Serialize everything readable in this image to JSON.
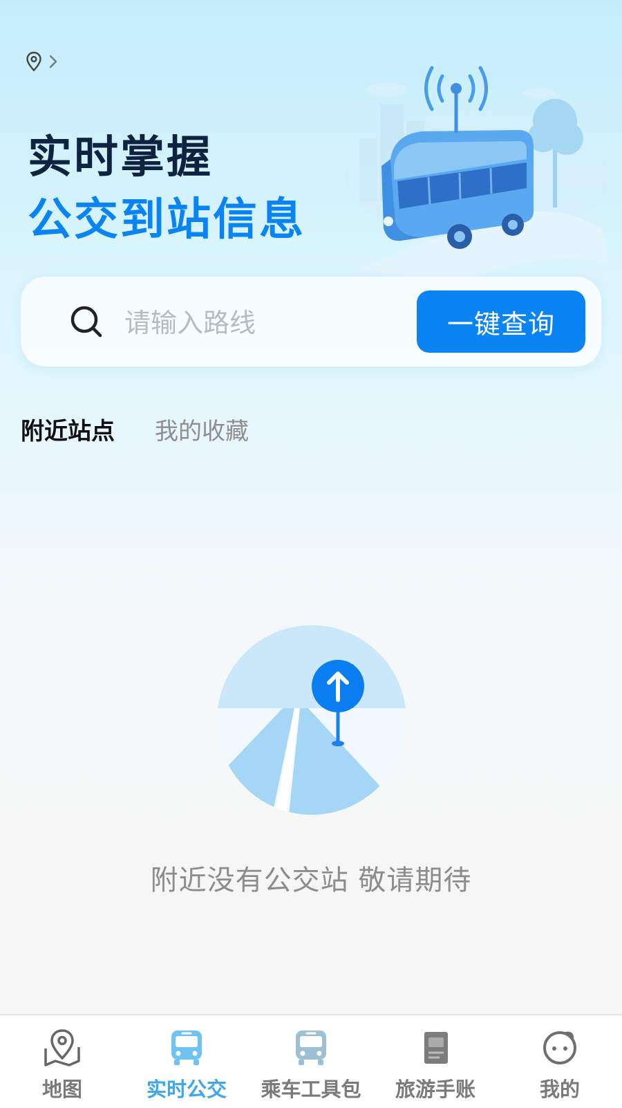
{
  "header": {
    "location_icon": "location-pin-icon",
    "chevron_icon": "chevron-right-icon",
    "headline_line1": "实时掌握",
    "headline_line2": "公交到站信息",
    "hero_image": "bus-with-signal-illustration"
  },
  "search": {
    "icon": "search-icon",
    "placeholder": "请输入路线",
    "value": "",
    "button_label": "一键查询"
  },
  "tabs": [
    {
      "label": "附近站点",
      "active": true
    },
    {
      "label": "我的收藏",
      "active": false
    }
  ],
  "empty_state": {
    "illustration": "road-with-up-arrow-sign-illustration",
    "message": "附近没有公交站 敬请期待"
  },
  "bottom_nav": [
    {
      "label": "地图",
      "icon": "map-pin-icon",
      "active": false
    },
    {
      "label": "实时公交",
      "icon": "bus-icon",
      "active": true
    },
    {
      "label": "乘车工具包",
      "icon": "bus-icon",
      "active": false
    },
    {
      "label": "旅游手账",
      "icon": "notebook-icon",
      "active": false
    },
    {
      "label": "我的",
      "icon": "smiley-icon",
      "active": false
    }
  ],
  "colors": {
    "accent": "#0a84f3",
    "headline_dark": "#0f2240",
    "nav_active": "#3ea7ec",
    "nav_inactive": "#7a7a7a"
  }
}
